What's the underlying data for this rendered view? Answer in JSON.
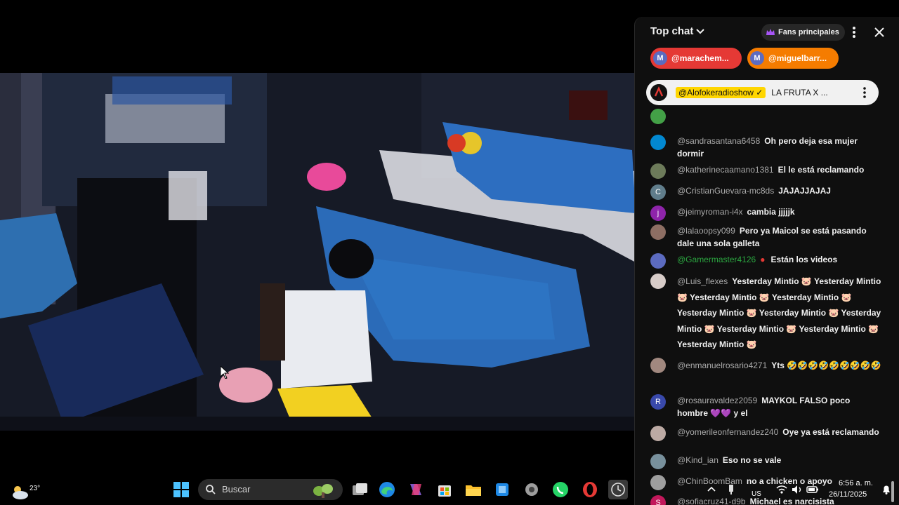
{
  "chat": {
    "title": "Top chat",
    "fans_label": "Fans principales",
    "tickers": [
      {
        "avatar": "M",
        "name": "@marachem...",
        "color": "#e53935"
      },
      {
        "avatar": "M",
        "name": "@miguelbarr...",
        "color": "#f57c00"
      }
    ],
    "pinned": {
      "author": "@Alofokeradioshow ✓",
      "text": "LA FRUTA X ..."
    },
    "messages": [
      {
        "avatar": "",
        "avatar_color": "#43a047",
        "author": "@sandrasantana6458",
        "text": "Oh pero deja esa mujer dormir"
      },
      {
        "avatar": "",
        "avatar_color": "#6d7b5a",
        "author": "@katherinecaamano1381",
        "text": "El le está reclamando"
      },
      {
        "avatar": "C",
        "avatar_color": "#607d8b",
        "author": "@CristianGuevara-mc8ds",
        "text": "JAJAJJAJAJ"
      },
      {
        "avatar": "j",
        "avatar_color": "#8e24aa",
        "author": "@jeimyroman-i4x",
        "text": "cambia jjjjjk"
      },
      {
        "avatar": "",
        "avatar_color": "#8d6e63",
        "author": "@lalaoopsy099",
        "text": "Pero ya Maicol se está pasando dale una sola galleta"
      },
      {
        "avatar": "",
        "avatar_color": "#5c6bc0",
        "author": "@Gamermaster4126",
        "text": "Están los videos"
      },
      {
        "avatar": "",
        "avatar_color": "#d7ccc8",
        "author": "@Luis_flexes",
        "text": "Yesterday Mintio 🐷 Yesterday Mintio 🐷 Yesterday Mintio 🐷 Yesterday Mintio 🐷 Yesterday Mintio 🐷 Yesterday Mintio 🐷 Yesterday Mintio 🐷 Yesterday Mintio 🐷 Yesterday Mintio 🐷 Yesterday Mintio 🐷"
      },
      {
        "avatar": "",
        "avatar_color": "#a1887f",
        "author": "@enmanuelrosario4271",
        "text": "Yts 🤣🤣🤣🤣🤣🤣🤣🤣🤣"
      },
      {
        "avatar": "R",
        "avatar_color": "#3949ab",
        "author": "@rosauravaldez2059",
        "text": "MAYKOL FALSO poco hombre 💜💜 y el"
      },
      {
        "avatar": "",
        "avatar_color": "#bcaaa4",
        "author": "@yomerileonfernandez240",
        "text": "Oye ya está reclamando"
      },
      {
        "avatar": "",
        "avatar_color": "#78909c",
        "author": "@Kind_ian",
        "text": "Eso no se vale"
      },
      {
        "avatar": "",
        "avatar_color": "#9e9e9e",
        "author": "@ChinBoomBam",
        "text": "no a chicken o apoyo"
      },
      {
        "avatar": "S",
        "avatar_color": "#c2185b",
        "author": "@sofiacruz41-d9b",
        "text": "Michael es narcisista"
      }
    ]
  },
  "taskbar": {
    "weather_temp": "23°",
    "search_placeholder": "Buscar",
    "lang": "US",
    "time": "6:56 a. m.",
    "date": "26/11/2025"
  },
  "colors": {
    "chat_bg": "#0f0f0f",
    "pinned_author_highlight": "#ffd600",
    "ticker_red": "#e53935",
    "ticker_orange": "#f57c00"
  }
}
